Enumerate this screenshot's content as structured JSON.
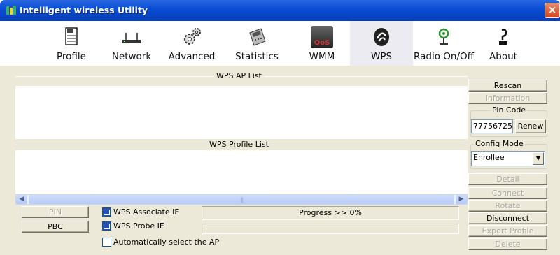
{
  "window": {
    "title": "Intelligent wireless Utility",
    "close_glyph": "×"
  },
  "toolbar": {
    "items": [
      {
        "label": "Profile",
        "icon": "profile-icon"
      },
      {
        "label": "Network",
        "icon": "network-icon"
      },
      {
        "label": "Advanced",
        "icon": "advanced-icon"
      },
      {
        "label": "Statistics",
        "icon": "statistics-icon"
      },
      {
        "label": "WMM",
        "icon": "wmm-qos-icon"
      },
      {
        "label": "WPS",
        "icon": "wps-icon",
        "active": true
      },
      {
        "label": "Radio On/Off",
        "icon": "radio-icon"
      },
      {
        "label": "About",
        "icon": "about-icon"
      }
    ],
    "wmm_icon_text": "QoS"
  },
  "wps": {
    "ap_list_title": "WPS AP List",
    "profile_list_title": "WPS Profile List",
    "buttons": {
      "rescan": "Rescan",
      "information": "Information",
      "renew": "Renew",
      "detail": "Detail",
      "connect": "Connect",
      "rotate": "Rotate",
      "disconnect": "Disconnect",
      "export_profile": "Export Profile",
      "delete": "Delete",
      "pin": "PIN",
      "pbc": "PBC"
    },
    "pin_code": {
      "label": "Pin Code",
      "value": "77756725"
    },
    "config_mode": {
      "label": "Config Mode",
      "selected": "Enrollee"
    },
    "options": {
      "associate_ie": {
        "label": "WPS Associate IE",
        "checked": true
      },
      "probe_ie": {
        "label": "WPS Probe IE",
        "checked": true
      },
      "auto_select": {
        "label": "Automatically select the AP",
        "checked": false
      }
    },
    "progress_text": "Progress >> 0%"
  },
  "colors": {
    "titlebar": "#0a4fd6",
    "dialog_bg": "#ece9d8",
    "checkbox_checked": "#254eb4"
  }
}
